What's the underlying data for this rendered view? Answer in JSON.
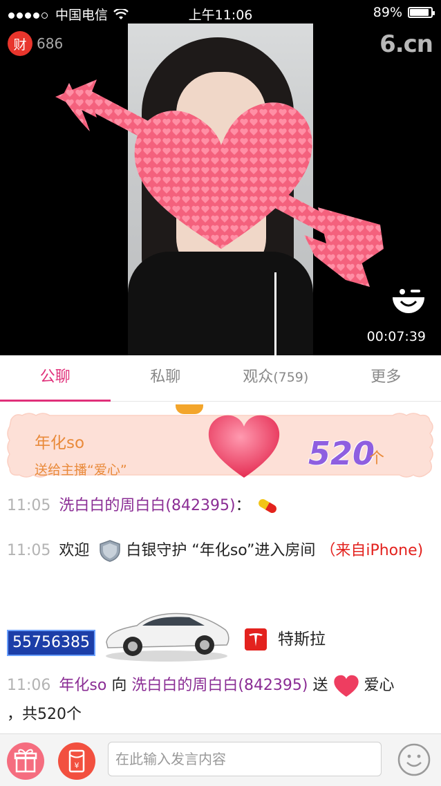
{
  "status_bar": {
    "carrier": "中国电信",
    "time": "上午11:06",
    "battery": "89%",
    "battery_level": 0.89
  },
  "header": {
    "wealth_badge": "财",
    "wealth_value": "686",
    "logo": "6.cn"
  },
  "video": {
    "timer": "00:07:39",
    "overlay_icon": "wink-face-icon"
  },
  "tabs": [
    {
      "label": "公聊",
      "active": true
    },
    {
      "label": "私聊",
      "active": false
    },
    {
      "label": "观众",
      "count": "(759)",
      "active": false
    },
    {
      "label": "更多",
      "active": false
    }
  ],
  "gift_banner": {
    "sender": "年化so",
    "desc": "送给主播“爱心”",
    "count": "520",
    "unit": "个"
  },
  "messages": [
    {
      "time": "11:05",
      "user": "洗白白的周白白(842395)",
      "sep": "："
    },
    {
      "time": "11:05",
      "welcome": "欢迎",
      "guard": "白银守护 “年化so”进入房间",
      "source": "（来自iPhone)"
    },
    {
      "time": "11:06",
      "from": "年化so",
      "to_word": "向",
      "to": "洗白白的周白白(842395)",
      "send_word": "送",
      "gift": "爱心",
      "total": "，共520个"
    }
  ],
  "tesla_row": {
    "user_id": "55756385",
    "car_name": "特斯拉"
  },
  "input_bar": {
    "placeholder": "在此输入发言内容"
  },
  "colors": {
    "accent": "#e0307a",
    "username": "#8a2c94",
    "source": "#e3221e",
    "gift_text": "#e98a3a"
  }
}
